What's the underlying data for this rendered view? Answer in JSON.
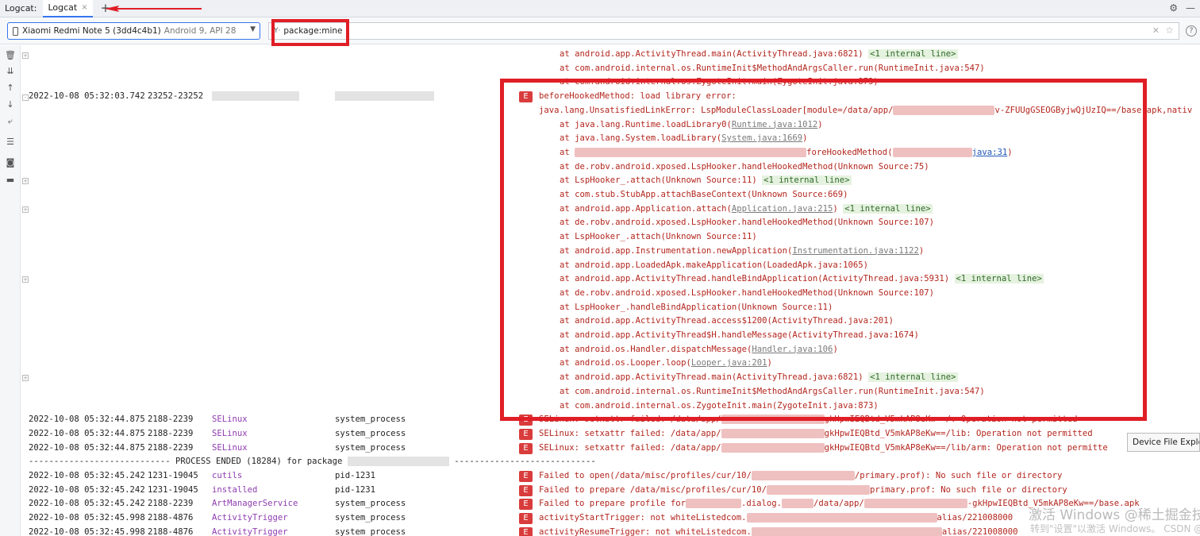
{
  "tabbar": {
    "tool_label": "Logcat:",
    "tab_label": "Logcat",
    "tab_close": "×",
    "add_label": "+"
  },
  "toolbar": {
    "device_name": "Xiaomi Redmi Note 5 (3dd4c4b1)",
    "device_meta": "Android 9, API 28",
    "filter_value": "package:mine",
    "help_label": "?"
  },
  "top_lines": [
    {
      "msg": "at android.app.ActivityThread.main(ActivityThread.java:6821)",
      "badge": "<1 internal line>"
    },
    {
      "msg": "at com.android.internal.os.RuntimeInit$MethodAndArgsCaller.run(RuntimeInit.java:547)"
    },
    {
      "msg": "at com.android.internal.os.ZygoteInit.main(ZygoteInit.java:873)"
    }
  ],
  "error_entry": {
    "date": "2022-10-08 05:32:03.742",
    "pid": "23252-23252",
    "level": "E",
    "headline": "beforeHookedMethod: load library error:",
    "exception_prefix": "java.lang.UnsatisfiedLinkError: LspModuleClassLoader[module=/data/app/",
    "exception_suffix": "v-ZFUUgGSEOGByjwQjUzIQ==/base.apk,nativ",
    "frames": [
      {
        "pre": "at java.lang.Runtime.loadLibrary0(",
        "link": "Runtime.java:1012",
        "post": ")"
      },
      {
        "pre": "at java.lang.System.loadLibrary(",
        "link": "System.java:1669",
        "post": ")"
      },
      {
        "pre": "at ",
        "mid": "foreHookedMethod(",
        "blue": "java:31",
        "post": ")"
      },
      {
        "pre": "at de.robv.android.xposed.LspHooker.handleHookedMethod(Unknown Source:75)"
      },
      {
        "pre": "at LspHooker_.attach(Unknown Source:11)",
        "badge": "<1 internal line>"
      },
      {
        "pre": "at com.stub.StubApp.attachBaseContext(Unknown Source:669)"
      },
      {
        "pre": "at android.app.Application.attach(",
        "link": "Application.java:215",
        "post": ")",
        "badge": "<1 internal line>"
      },
      {
        "pre": "at de.robv.android.xposed.LspHooker.handleHookedMethod(Unknown Source:107)"
      },
      {
        "pre": "at LspHooker_.attach(Unknown Source:11)"
      },
      {
        "pre": "at android.app.Instrumentation.newApplication(",
        "link": "Instrumentation.java:1122",
        "post": ")"
      },
      {
        "pre": "at android.app.LoadedApk.makeApplication(LoadedApk.java:1065)"
      },
      {
        "pre": "at android.app.ActivityThread.handleBindApplication(ActivityThread.java:5931)",
        "badge": "<1 internal line>"
      },
      {
        "pre": "at de.robv.android.xposed.LspHooker.handleHookedMethod(Unknown Source:107)"
      },
      {
        "pre": "at LspHooker_.handleBindApplication(Unknown Source:11)"
      },
      {
        "pre": "at android.app.ActivityThread.access$1200(ActivityThread.java:201)"
      },
      {
        "pre": "at android.app.ActivityThread$H.handleMessage(ActivityThread.java:1674)"
      },
      {
        "pre": "at android.os.Handler.dispatchMessage(",
        "link": "Handler.java:106",
        "post": ")"
      },
      {
        "pre": "at android.os.Looper.loop(",
        "link": "Looper.java:201",
        "post": ")"
      },
      {
        "pre": "at android.app.ActivityThread.main(ActivityThread.java:6821)",
        "badge": "<1 internal line>"
      },
      {
        "pre": "at com.android.internal.os.RuntimeInit$MethodAndArgsCaller.run(RuntimeInit.java:547)"
      },
      {
        "pre": "at com.android.internal.os.ZygoteInit.main(ZygoteInit.java:873)"
      }
    ]
  },
  "bottom_rows": [
    {
      "date": "2022-10-08 05:32:44.875",
      "pid": "2188-2239",
      "tag": "SELinux",
      "pkg": "system_process",
      "level": "E",
      "msg_pre": "SELinux:  setxattr failed: /data/app/",
      "msg_post": "gkHpwIEQBtd_V5mkAP8eKw==/:  Operation not permitted"
    },
    {
      "date": "2022-10-08 05:32:44.875",
      "pid": "2188-2239",
      "tag": "SELinux",
      "pkg": "system_process",
      "level": "E",
      "msg_pre": "SELinux:  setxattr failed: /data/app/",
      "msg_post": "gkHpwIEQBtd_V5mkAP8eKw==/lib:  Operation not permitted"
    },
    {
      "date": "2022-10-08 05:32:44.875",
      "pid": "2188-2239",
      "tag": "SELinux",
      "pkg": "system_process",
      "level": "E",
      "msg_pre": "SELinux:  setxattr failed: /data/app/",
      "msg_post": "gkHpwIEQBtd_V5mkAP8eKw==/lib/arm:  Operation not permitte"
    }
  ],
  "process_ended": {
    "left": "---------------------------- PROCESS ENDED (18284) for package",
    "right": "----------------------------"
  },
  "tail_rows": [
    {
      "date": "2022-10-08 05:32:45.242",
      "pid": "1231-19045",
      "tag": "cutils",
      "pkg": "pid-1231",
      "level": "E",
      "msg_pre": "Failed to open(/data/misc/profiles/cur/10/",
      "msg_post": "/primary.prof): No such file or directory"
    },
    {
      "date": "2022-10-08 05:32:45.242",
      "pid": "1231-19045",
      "tag": "installed",
      "pkg": "pid-1231",
      "level": "E",
      "msg_pre": "Failed to prepare /data/misc/profiles/cur/10/",
      "msg_post": "primary.prof: No such file or directory"
    },
    {
      "date": "2022-10-08 05:32:45.242",
      "pid": "2188-2239",
      "tag": "ArtManagerService",
      "pkg": "system_process",
      "level": "E",
      "msg_pre": "Failed to prepare profile for",
      "msg_mid": ".dialog.",
      "msg_mid2": "/data/app/",
      "msg_post": "-gkHpwIEQBtd_V5mkAP8eKw==/base.apk"
    },
    {
      "date": "2022-10-08 05:32:45.998",
      "pid": "2188-4876",
      "tag": "ActivityTrigger",
      "pkg": "system_process",
      "level": "E",
      "msg_pre": "activityStartTrigger: not whiteListedcom.",
      "msg_post": "alias/221008000"
    },
    {
      "date": "2022-10-08 05:32:45.998",
      "pid": "2188-4876",
      "tag": "ActivityTrigger",
      "pkg": "system_process",
      "level": "E",
      "msg_pre": "activityResumeTrigger: not whiteListedcom.",
      "msg_post": "alias/221008000"
    }
  ],
  "tooltip": "Device File Explorer",
  "watermark": {
    "line1": "激活 Windows",
    "line2": "转到\"设置\"以激活 Windows。",
    "badge": "@稀土掘金技术社区",
    "csdn": "CSDN @Wuyang"
  }
}
